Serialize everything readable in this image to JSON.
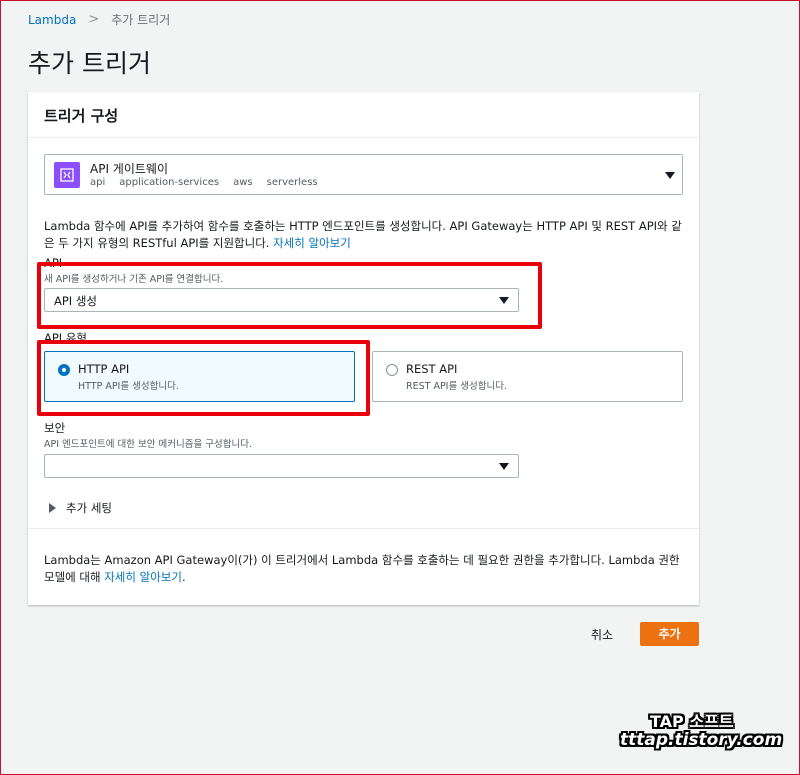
{
  "breadcrumb": {
    "root": "Lambda",
    "current": "추가 트리거"
  },
  "page_title": "추가 트리거",
  "card": {
    "title": "트리거 구성",
    "trigger": {
      "name": "API 게이트웨이",
      "tags": [
        "api",
        "application-services",
        "aws",
        "serverless"
      ],
      "icon": "api-gateway-icon",
      "icon_color": "#8c4fff"
    },
    "description": "Lambda 함수에 API를 추가하여 함수를 호출하는 HTTP 엔드포인트를 생성합니다. API Gateway는 HTTP API 및 REST API와 같은 두 가지 유형의 RESTful API를 지원합니다.",
    "learn_more": "자세히 알아보기",
    "api": {
      "label": "API",
      "sublabel": "새 API를 생성하거나 기존 API를 연결합니다.",
      "value": "API 생성"
    },
    "api_type": {
      "label": "API 유형",
      "options": [
        {
          "title": "HTTP API",
          "desc": "HTTP API를 생성합니다.",
          "selected": true
        },
        {
          "title": "REST API",
          "desc": "REST API를 생성합니다.",
          "selected": false
        }
      ]
    },
    "security": {
      "label": "보안",
      "sublabel": "API 엔드포인트에 대한 보안 메커니즘을 구성합니다.",
      "value": ""
    },
    "additional_settings": "추가 세팅",
    "footer": {
      "text": "Lambda는 Amazon API Gateway이(가) 이 트리거에서 Lambda 함수를 호출하는 데 필요한 권한을 추가합니다. Lambda 권한 모델에 대해",
      "link": "자세히 알아보기",
      "suffix": "."
    }
  },
  "buttons": {
    "cancel": "취소",
    "add": "추가"
  },
  "watermark": {
    "line1": "TAP 소프트",
    "line2": "tttap.tistory.com"
  },
  "colors": {
    "accent": "#0073bb",
    "primary_button": "#ec7211",
    "highlight": "#e8000b"
  }
}
